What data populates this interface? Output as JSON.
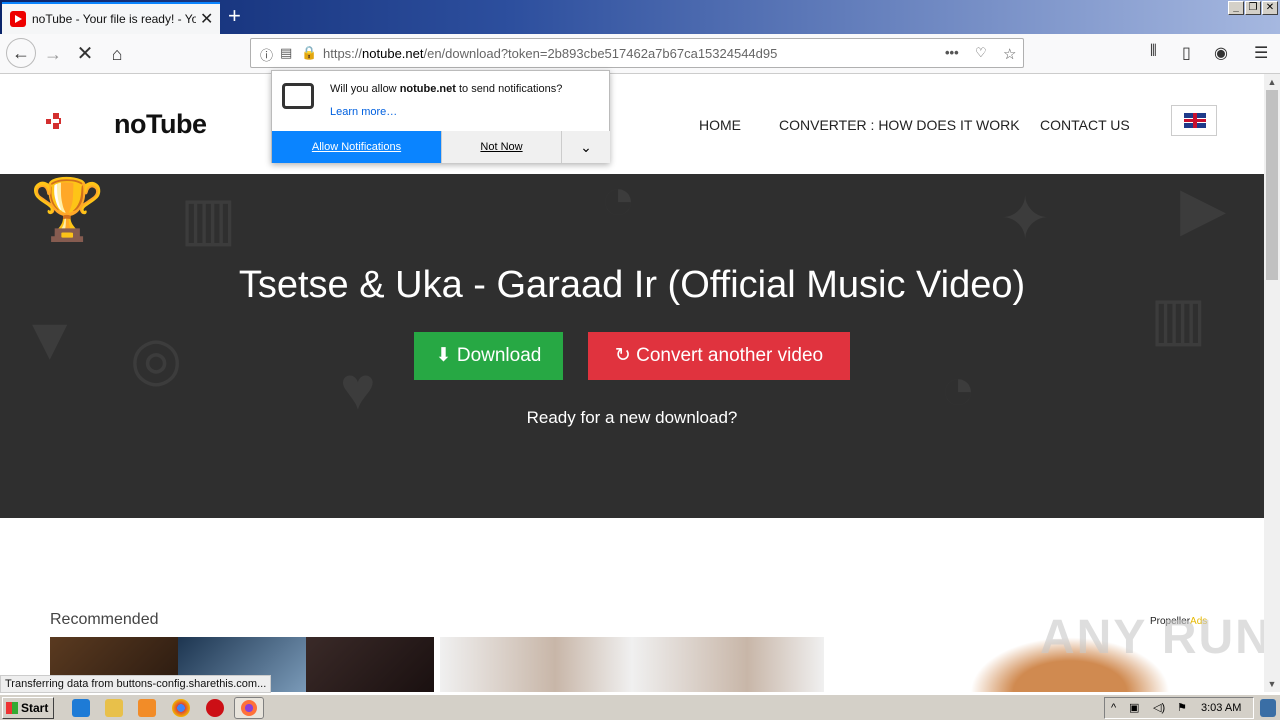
{
  "browser": {
    "tab_title": "noTube - Your file is ready! - YouT",
    "tab_close": "✕",
    "new_tab": "+",
    "url_domain": "notube.net",
    "url_prefix": "https://",
    "url_path": "/en/download?token=2b893cbe517462a7b67ca15324544d95",
    "window_controls": [
      "_",
      "❐",
      "✕"
    ]
  },
  "notification": {
    "question_prefix": "Will you allow ",
    "question_domain": "notube.net",
    "question_suffix": " to send notifications?",
    "learn_more": "Learn more…",
    "allow_label": "Allow Notifications",
    "not_now_label": "Not Now"
  },
  "site": {
    "logo_text": "noTube",
    "menu": [
      "HOME",
      "CONVERTER : HOW DOES IT WORK",
      "CONTACT US"
    ],
    "video_title": "Tsetse & Uka - Garaad Ir (Official Music Video)",
    "download_label": "Download",
    "convert_label": "Convert another video",
    "ready_text": "Ready for a new download?",
    "recommended_label": "Recommended",
    "propeller_a": "Propeller",
    "propeller_b": "Ads"
  },
  "watermark": "ANY RUN",
  "status_text": "Transferring data from buttons-config.sharethis.com...",
  "taskbar": {
    "start_label": "Start",
    "clock": "3:03 AM"
  },
  "colors": {
    "download_green": "#27a844",
    "convert_red": "#e0333e",
    "allow_blue": "#0a84ff",
    "brand_red": "#d32f2f"
  }
}
